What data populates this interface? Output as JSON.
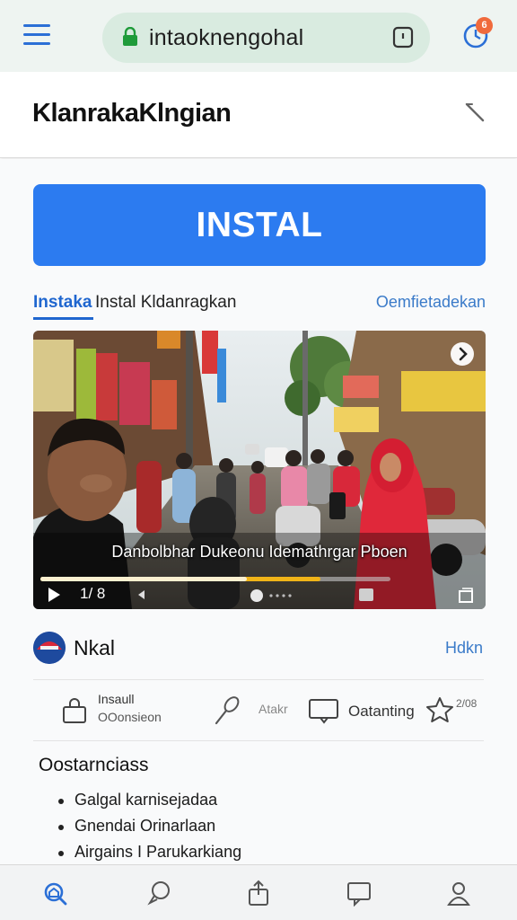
{
  "browser": {
    "url": "intaoknengohal",
    "badge_count": "6"
  },
  "header": {
    "title": "KlanrakaKlngian"
  },
  "install_button": {
    "label": "INSTAL"
  },
  "tabs": {
    "active": "Instaka",
    "secondary": "Instal Kldanragkan",
    "link": "Oemfietadekan"
  },
  "video": {
    "caption": "Danbolbhar Dukeonu Idemathrgar Pboen",
    "time": "1/ 8",
    "progress_played": 0.59,
    "progress_buffered": 0.8
  },
  "channel": {
    "name": "Nkal",
    "link": "Hdkn"
  },
  "actions": [
    {
      "icon": "bag-icon",
      "label_line1": "Insaull",
      "label_line2": "OOonsieon"
    },
    {
      "icon": "mic-icon",
      "label": "Atakr"
    },
    {
      "icon": "comment-icon",
      "label": "Oatanting"
    },
    {
      "icon": "star-icon",
      "label": "2/08"
    }
  ],
  "description": {
    "title": "Oostarnciass",
    "items": [
      "Galgal karnisejadaa",
      "Gnendai Orinarlaan",
      "Airgains I Parukarkiang"
    ]
  },
  "bottom_nav": [
    {
      "icon": "home-search-icon"
    },
    {
      "icon": "chat-icon"
    },
    {
      "icon": "share-icon"
    },
    {
      "icon": "message-icon"
    },
    {
      "icon": "profile-icon"
    }
  ],
  "colors": {
    "accent": "#2c7bf0",
    "link": "#3b7bc9",
    "progress": "#f0b418",
    "badge": "#f06a3c"
  }
}
